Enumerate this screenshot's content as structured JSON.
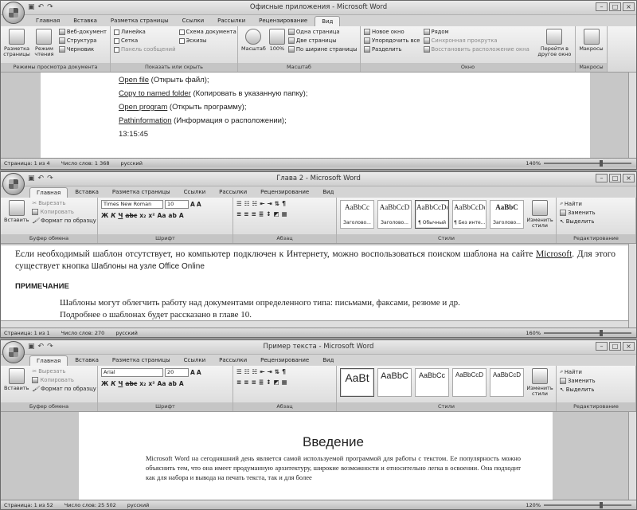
{
  "w1": {
    "title": "Офисные приложения - Microsoft Word",
    "tabs": [
      "Главная",
      "Вставка",
      "Разметка страницы",
      "Ссылки",
      "Рассылки",
      "Рецензирование",
      "Вид"
    ],
    "g1": {
      "b1": "Разметка страницы",
      "b2": "Режим чтения",
      "s1": "Веб-документ",
      "s2": "Структура",
      "s3": "Черновик",
      "label": "Режимы просмотра документа"
    },
    "g2": {
      "c1": "Линейка",
      "c2": "Сетка",
      "c3": "Панель сообщений",
      "c4": "Схема документа",
      "c5": "Эскизы",
      "label": "Показать или скрыть"
    },
    "g3": {
      "b1": "Масштаб",
      "b2": "100%",
      "s1": "Одна страница",
      "s2": "Две страницы",
      "s3": "По ширине страницы",
      "label": "Масштаб"
    },
    "g4": {
      "s1": "Новое окно",
      "s2": "Упорядочить все",
      "s3": "Разделить",
      "s4": "Рядом",
      "s5": "Синхронная прокрутка",
      "s6": "Восстановить расположение окна",
      "b1": "Перейти в другое окно",
      "label": "Окно"
    },
    "g5": {
      "b1": "Макросы",
      "label": "Макросы"
    },
    "lines": [
      {
        "u": "Open file",
        "r": " (Открыть файл);"
      },
      {
        "u": "Copy to named folder",
        "r": " (Копировать в указанную папку);"
      },
      {
        "u": "Open program",
        "r": " (Открыть программу);"
      },
      {
        "u": "Pathinformation",
        "r": " (Информация о расположении);"
      },
      {
        "u": "",
        "r": "13:15:45"
      }
    ],
    "status": {
      "page": "Страница: 1 из 4",
      "words": "Число слов: 1 368",
      "lang": "русский",
      "zoom": "140%"
    }
  },
  "w2": {
    "title": "Глава 2 - Microsoft Word",
    "tabs": [
      "Главная",
      "Вставка",
      "Разметка страницы",
      "Ссылки",
      "Рассылки",
      "Рецензирование",
      "Вид"
    ],
    "clip": {
      "paste": "Вставить",
      "cut": "Вырезать",
      "copy": "Копировать",
      "format": "Формат по образцу",
      "label": "Буфер обмена"
    },
    "font": {
      "name": "Times New Roman",
      "size": "10",
      "label": "Шрифт"
    },
    "para": {
      "label": "Абзац"
    },
    "styles": [
      {
        "p": "AaBbCc",
        "n": "Заголово..."
      },
      {
        "p": "AaBbCcD",
        "n": "Заголово..."
      },
      {
        "p": "AaBbCcDc",
        "n": "¶ Обычный"
      },
      {
        "p": "AaBbCcDc",
        "n": "¶ Без инте..."
      },
      {
        "p": "AaBbC",
        "n": "Заголово..."
      }
    ],
    "change": "Изменить стили",
    "stylelabel": "Стили",
    "edit": {
      "find": "Найти",
      "replace": "Заменить",
      "select": "Выделить",
      "label": "Редактирование"
    },
    "p1a": "Если необходимый шаблон отсутствует, но компьютер подключен к Интернету, можно воспользоваться поиском шаблона на сайте ",
    "p1b": "Microsoft",
    "p1c": ". Для этого существует кнопка ",
    "p1d": "Шаблоны на узле Office Online",
    "note": "ПРИМЕЧАНИЕ",
    "p2": "Шаблоны могут облегчить работу над документами определенного типа: письмами, факсами, резюме и др.",
    "p3": "Подробнее о шаблонах будет рассказано в главе 10.",
    "status": {
      "page": "Страница: 1 из 1",
      "words": "Число слов: 270",
      "lang": "русский",
      "zoom": "160%"
    }
  },
  "w3": {
    "title": "Пример текста - Microsoft Word",
    "tabs": [
      "Главная",
      "Вставка",
      "Разметка страницы",
      "Ссылки",
      "Рассылки",
      "Рецензирование",
      "Вид"
    ],
    "font": {
      "name": "Arial",
      "size": "20"
    },
    "styles": [
      {
        "p": "AaBt",
        "n": ""
      },
      {
        "p": "AaBbC",
        "n": ""
      },
      {
        "p": "AaBbCc",
        "n": ""
      },
      {
        "p": "AaBbCcD",
        "n": ""
      },
      {
        "p": "AaBbCcD",
        "n": ""
      }
    ],
    "heading": "Введение",
    "body1": "Microsoft Word на сегодняшний день является самой используемой программой для работы с текстом. Ее популярность можно объяснить тем, что она имеет продуманную архитектуру, широкие возможности и относительно легка в освоении. Она подходит как для набора и вывода на печать текста, так и для более",
    "status": {
      "page": "Страница: 1 из 52",
      "words": "Число слов: 25 502",
      "lang": "русский",
      "zoom": "120%"
    }
  }
}
